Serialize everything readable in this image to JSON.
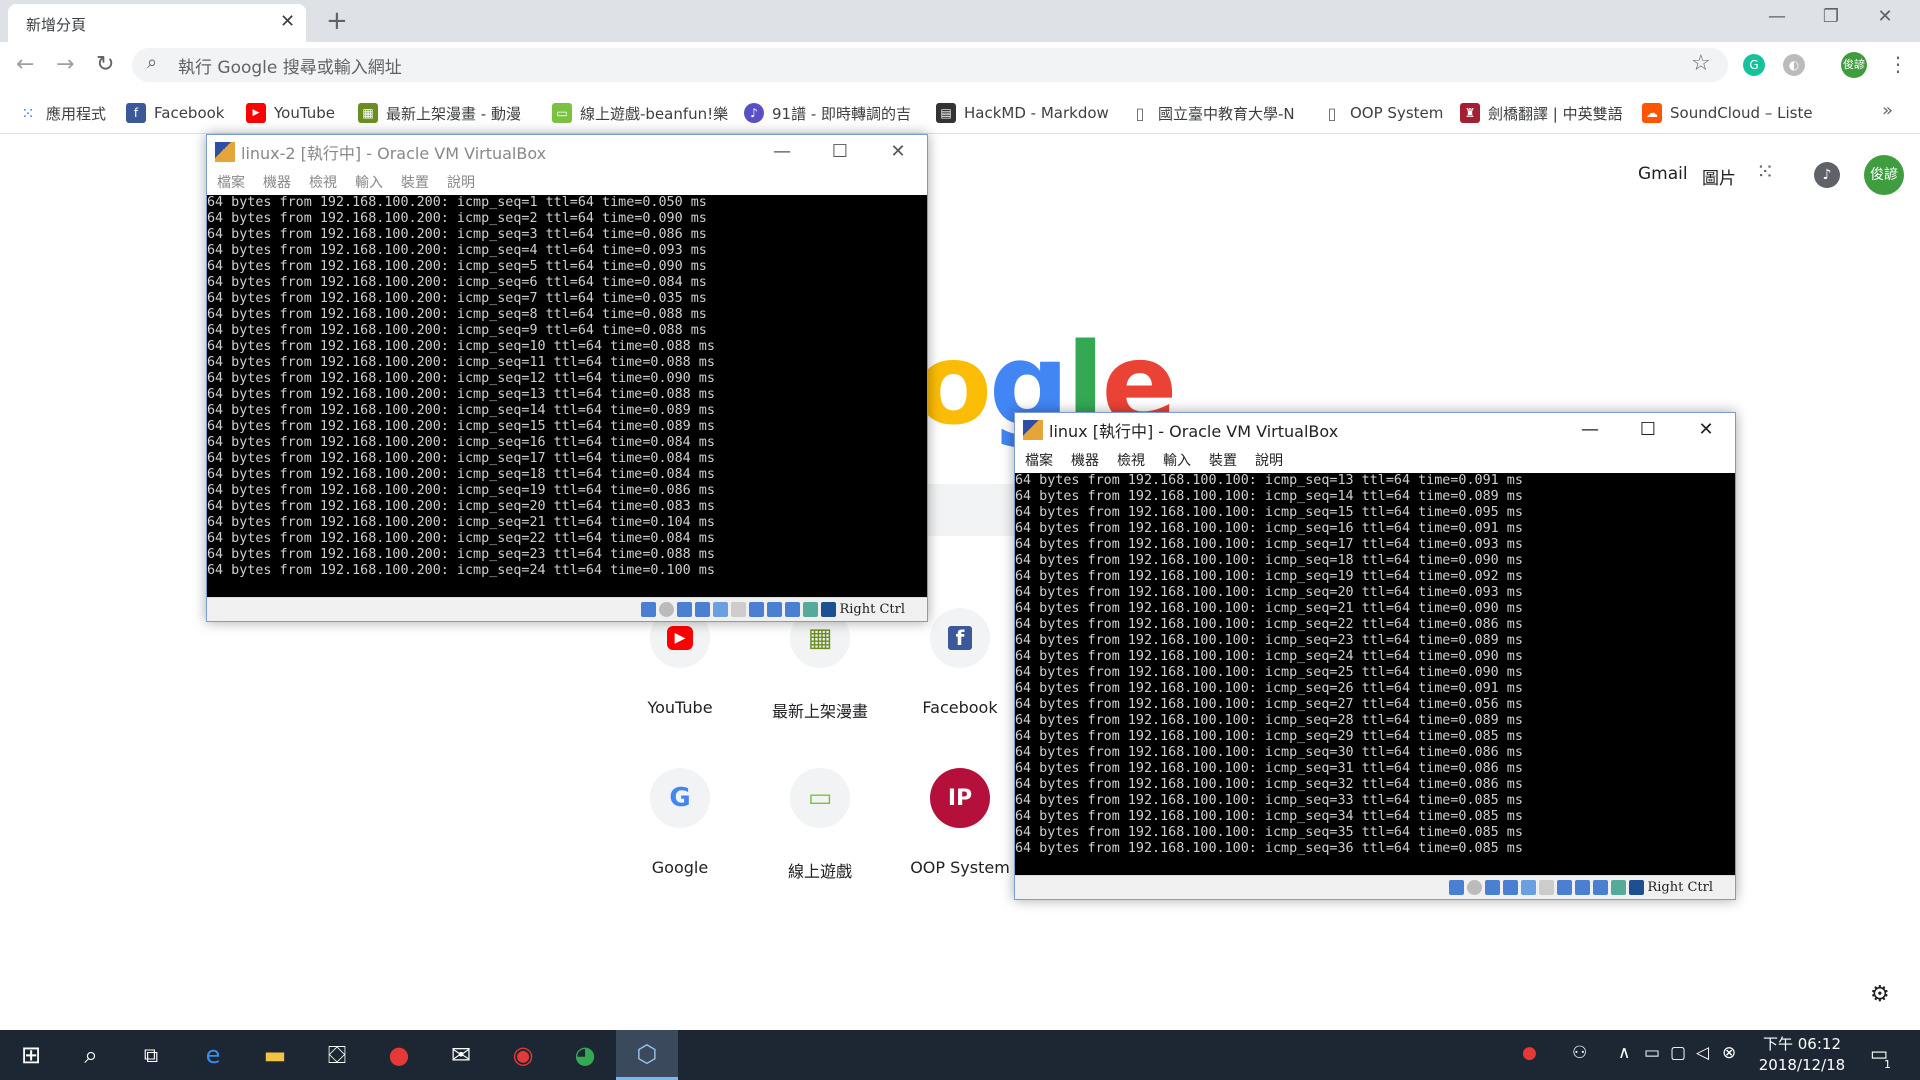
{
  "browser": {
    "tab_title": "新增分頁",
    "tab_close": "✕",
    "new_tab": "+",
    "omnibox_placeholder": "執行 Google 搜尋或輸入網址",
    "profile_initials": "俊諺",
    "ext_grammarly": "G"
  },
  "bookmarks": [
    {
      "label": "應用程式",
      "icon": "apps-grid-icon",
      "color": "#4285f4"
    },
    {
      "label": "Facebook",
      "icon": "facebook-icon",
      "color": "#3b5998"
    },
    {
      "label": "YouTube",
      "icon": "youtube-icon",
      "color": "#ff0000"
    },
    {
      "label": "最新上架漫畫 - 動漫",
      "icon": "comic-icon",
      "color": "#6b8e23"
    },
    {
      "label": "線上遊戲-beanfun!樂",
      "icon": "gamepad-icon",
      "color": "#7cc242"
    },
    {
      "label": "91譜 - 即時轉調的吉",
      "icon": "music-score-icon",
      "color": "#5b4fc4"
    },
    {
      "label": "HackMD - Markdow",
      "icon": "document-icon",
      "color": "#333333"
    },
    {
      "label": "國立臺中教育大學-N",
      "icon": "page-icon",
      "color": "#888888"
    },
    {
      "label": "OOP System",
      "icon": "page-icon",
      "color": "#888888"
    },
    {
      "label": "劍橋翻譯 | 中英雙語",
      "icon": "cambridge-icon",
      "color": "#a31f34"
    },
    {
      "label": "SoundCloud – Liste",
      "icon": "soundcloud-icon",
      "color": "#ff5500"
    }
  ],
  "ntp": {
    "gmail": "Gmail",
    "images": "圖片",
    "logo": "oogle",
    "tiles": [
      {
        "label": "YouTube",
        "icon": "▶"
      },
      {
        "label": "最新上架漫畫",
        "icon": "▦"
      },
      {
        "label": "Facebook",
        "icon": "f"
      },
      {
        "label": "Google",
        "icon": "G"
      },
      {
        "label": "線上遊戲",
        "icon": "▭"
      },
      {
        "label": "OOP System",
        "icon": "IP"
      }
    ]
  },
  "vm1": {
    "title": "linux-2 [執行中] - Oracle VM VirtualBox",
    "menu": [
      "檔案",
      "機器",
      "檢視",
      "輸入",
      "裝置",
      "說明"
    ],
    "host_key": "Right Ctrl",
    "lines": [
      "64 bytes from 192.168.100.200: icmp_seq=1 ttl=64 time=0.050 ms",
      "64 bytes from 192.168.100.200: icmp_seq=2 ttl=64 time=0.090 ms",
      "64 bytes from 192.168.100.200: icmp_seq=3 ttl=64 time=0.086 ms",
      "64 bytes from 192.168.100.200: icmp_seq=4 ttl=64 time=0.093 ms",
      "64 bytes from 192.168.100.200: icmp_seq=5 ttl=64 time=0.090 ms",
      "64 bytes from 192.168.100.200: icmp_seq=6 ttl=64 time=0.084 ms",
      "64 bytes from 192.168.100.200: icmp_seq=7 ttl=64 time=0.035 ms",
      "64 bytes from 192.168.100.200: icmp_seq=8 ttl=64 time=0.088 ms",
      "64 bytes from 192.168.100.200: icmp_seq=9 ttl=64 time=0.088 ms",
      "64 bytes from 192.168.100.200: icmp_seq=10 ttl=64 time=0.088 ms",
      "64 bytes from 192.168.100.200: icmp_seq=11 ttl=64 time=0.088 ms",
      "64 bytes from 192.168.100.200: icmp_seq=12 ttl=64 time=0.090 ms",
      "64 bytes from 192.168.100.200: icmp_seq=13 ttl=64 time=0.088 ms",
      "64 bytes from 192.168.100.200: icmp_seq=14 ttl=64 time=0.089 ms",
      "64 bytes from 192.168.100.200: icmp_seq=15 ttl=64 time=0.089 ms",
      "64 bytes from 192.168.100.200: icmp_seq=16 ttl=64 time=0.084 ms",
      "64 bytes from 192.168.100.200: icmp_seq=17 ttl=64 time=0.084 ms",
      "64 bytes from 192.168.100.200: icmp_seq=18 ttl=64 time=0.084 ms",
      "64 bytes from 192.168.100.200: icmp_seq=19 ttl=64 time=0.086 ms",
      "64 bytes from 192.168.100.200: icmp_seq=20 ttl=64 time=0.083 ms",
      "64 bytes from 192.168.100.200: icmp_seq=21 ttl=64 time=0.104 ms",
      "64 bytes from 192.168.100.200: icmp_seq=22 ttl=64 time=0.084 ms",
      "64 bytes from 192.168.100.200: icmp_seq=23 ttl=64 time=0.088 ms",
      "64 bytes from 192.168.100.200: icmp_seq=24 ttl=64 time=0.100 ms"
    ]
  },
  "vm2": {
    "title": "linux [執行中] - Oracle VM VirtualBox",
    "menu": [
      "檔案",
      "機器",
      "檢視",
      "輸入",
      "裝置",
      "說明"
    ],
    "host_key": "Right Ctrl",
    "lines": [
      "64 bytes from 192.168.100.100: icmp_seq=13 ttl=64 time=0.091 ms",
      "64 bytes from 192.168.100.100: icmp_seq=14 ttl=64 time=0.089 ms",
      "64 bytes from 192.168.100.100: icmp_seq=15 ttl=64 time=0.095 ms",
      "64 bytes from 192.168.100.100: icmp_seq=16 ttl=64 time=0.091 ms",
      "64 bytes from 192.168.100.100: icmp_seq=17 ttl=64 time=0.093 ms",
      "64 bytes from 192.168.100.100: icmp_seq=18 ttl=64 time=0.090 ms",
      "64 bytes from 192.168.100.100: icmp_seq=19 ttl=64 time=0.092 ms",
      "64 bytes from 192.168.100.100: icmp_seq=20 ttl=64 time=0.093 ms",
      "64 bytes from 192.168.100.100: icmp_seq=21 ttl=64 time=0.090 ms",
      "64 bytes from 192.168.100.100: icmp_seq=22 ttl=64 time=0.086 ms",
      "64 bytes from 192.168.100.100: icmp_seq=23 ttl=64 time=0.089 ms",
      "64 bytes from 192.168.100.100: icmp_seq=24 ttl=64 time=0.090 ms",
      "64 bytes from 192.168.100.100: icmp_seq=25 ttl=64 time=0.090 ms",
      "64 bytes from 192.168.100.100: icmp_seq=26 ttl=64 time=0.091 ms",
      "64 bytes from 192.168.100.100: icmp_seq=27 ttl=64 time=0.056 ms",
      "64 bytes from 192.168.100.100: icmp_seq=28 ttl=64 time=0.089 ms",
      "64 bytes from 192.168.100.100: icmp_seq=29 ttl=64 time=0.085 ms",
      "64 bytes from 192.168.100.100: icmp_seq=30 ttl=64 time=0.086 ms",
      "64 bytes from 192.168.100.100: icmp_seq=31 ttl=64 time=0.086 ms",
      "64 bytes from 192.168.100.100: icmp_seq=32 ttl=64 time=0.086 ms",
      "64 bytes from 192.168.100.100: icmp_seq=33 ttl=64 time=0.085 ms",
      "64 bytes from 192.168.100.100: icmp_seq=34 ttl=64 time=0.085 ms",
      "64 bytes from 192.168.100.100: icmp_seq=35 ttl=64 time=0.085 ms",
      "64 bytes from 192.168.100.100: icmp_seq=36 ttl=64 time=0.085 ms"
    ]
  },
  "taskbar": {
    "time": "下午 06:12",
    "date": "2018/12/18",
    "notification_count": "1"
  },
  "colors": {
    "taskbar_bg": "#1c2733",
    "google_blue": "#4285f4",
    "google_red": "#ea4335",
    "google_yellow": "#fbbc05",
    "google_green": "#34a853",
    "profile_green": "#3f9c3f"
  }
}
